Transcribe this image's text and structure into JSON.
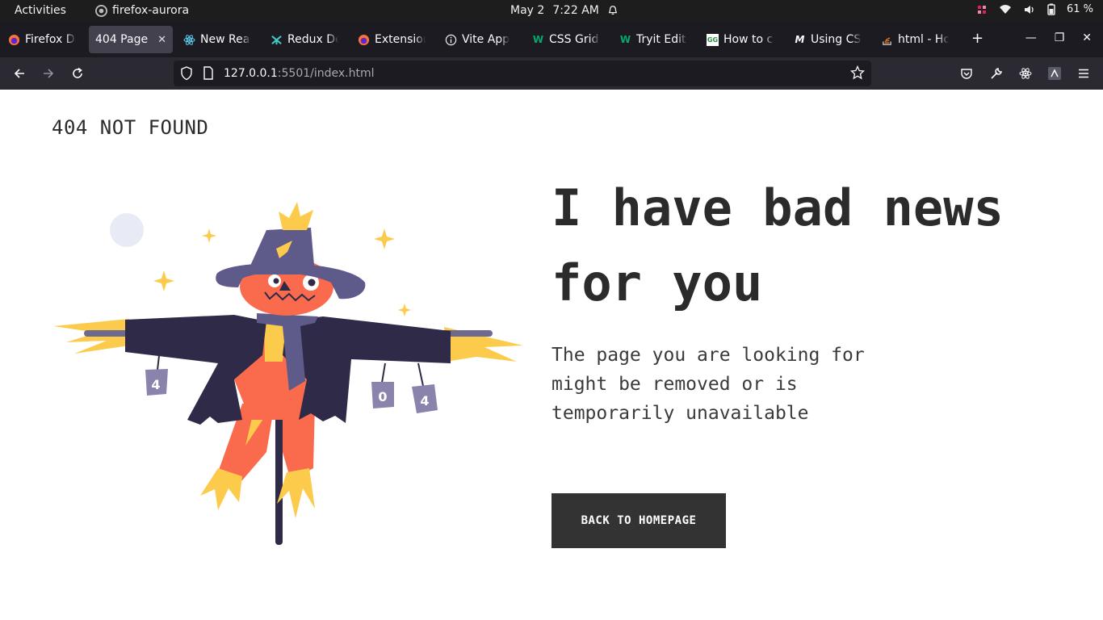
{
  "system_bar": {
    "activities": "Activities",
    "app_name": "firefox-aurora",
    "date": "May 2",
    "time": "7:22 AM",
    "battery": "61 %"
  },
  "tabs": [
    {
      "label": "Firefox Developer Edition",
      "icon": "firefox-icon"
    },
    {
      "label": "404 Page",
      "icon": "none",
      "active": true
    },
    {
      "label": "New React App",
      "icon": "react-icon"
    },
    {
      "label": "Redux DevTools",
      "icon": "redux-icon"
    },
    {
      "label": "Extensions",
      "icon": "firefox-icon"
    },
    {
      "label": "Vite App",
      "icon": "info-icon"
    },
    {
      "label": "CSS Grid Layout",
      "icon": "w3schools-icon"
    },
    {
      "label": "Tryit Editor",
      "icon": "w3schools-icon"
    },
    {
      "label": "How to create",
      "icon": "gfg-icon"
    },
    {
      "label": "Using CSS",
      "icon": "mdn-icon"
    },
    {
      "label": "html - How to",
      "icon": "stackoverflow-icon"
    }
  ],
  "address_bar": {
    "host": "127.0.0.1",
    "path": ":5501/index.html"
  },
  "page": {
    "brand": "404 NOT FOUND",
    "headline": "I have bad news for you",
    "description": "The page you are looking for might be removed or is temporarily unavailable",
    "cta_label": "BACK TO HOMEPAGE",
    "can_digits": [
      "4",
      "0",
      "4"
    ]
  },
  "colors": {
    "hat": "#5e5a8a",
    "jacket": "#2f2a48",
    "pumpkin": "#fa6a4c",
    "straw": "#fccb4c",
    "cta_bg": "#333333"
  }
}
